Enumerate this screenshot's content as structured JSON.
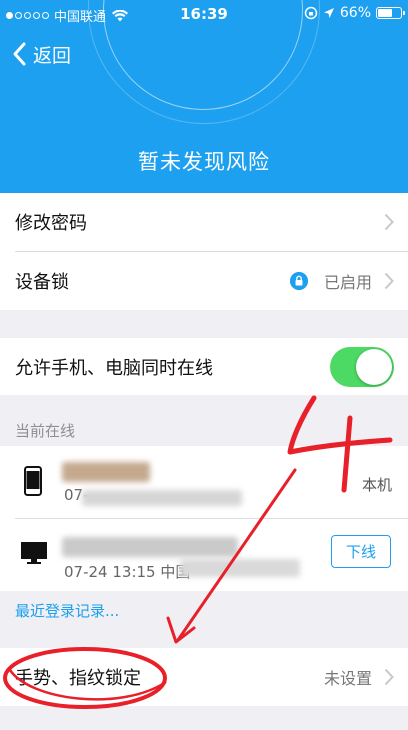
{
  "status_bar": {
    "carrier": "中国联通",
    "time": "16:39",
    "battery_text": "66%",
    "battery_level": 0.66
  },
  "nav": {
    "back_label": "返回"
  },
  "header": {
    "risk_status": "暂未发现风险"
  },
  "settings": {
    "change_password": {
      "title": "修改密码"
    },
    "device_lock": {
      "title": "设备锁",
      "status": "已启用"
    },
    "multi_online": {
      "title": "允许手机、电脑同时在线",
      "enabled": true
    }
  },
  "online_section": {
    "label": "当前在线",
    "devices": [
      {
        "type": "phone",
        "time": "07-",
        "badge": "本机"
      },
      {
        "type": "computer",
        "time": "07-24 13:15 中国",
        "action": "下线"
      }
    ],
    "recent_login_link": "最近登录记录..."
  },
  "gesture_lock": {
    "title": "手势、指纹锁定",
    "status": "未设置"
  },
  "annotation": {
    "number": "4",
    "color": "#e8202a"
  },
  "colors": {
    "accent": "#1da0ef",
    "toggle_on": "#4cd964",
    "background": "#efeff4"
  },
  "icons": [
    "back-chevron-icon",
    "wifi-icon",
    "lock-icon",
    "location-icon",
    "battery-icon",
    "chevron-right-icon",
    "phone-icon",
    "monitor-icon"
  ]
}
